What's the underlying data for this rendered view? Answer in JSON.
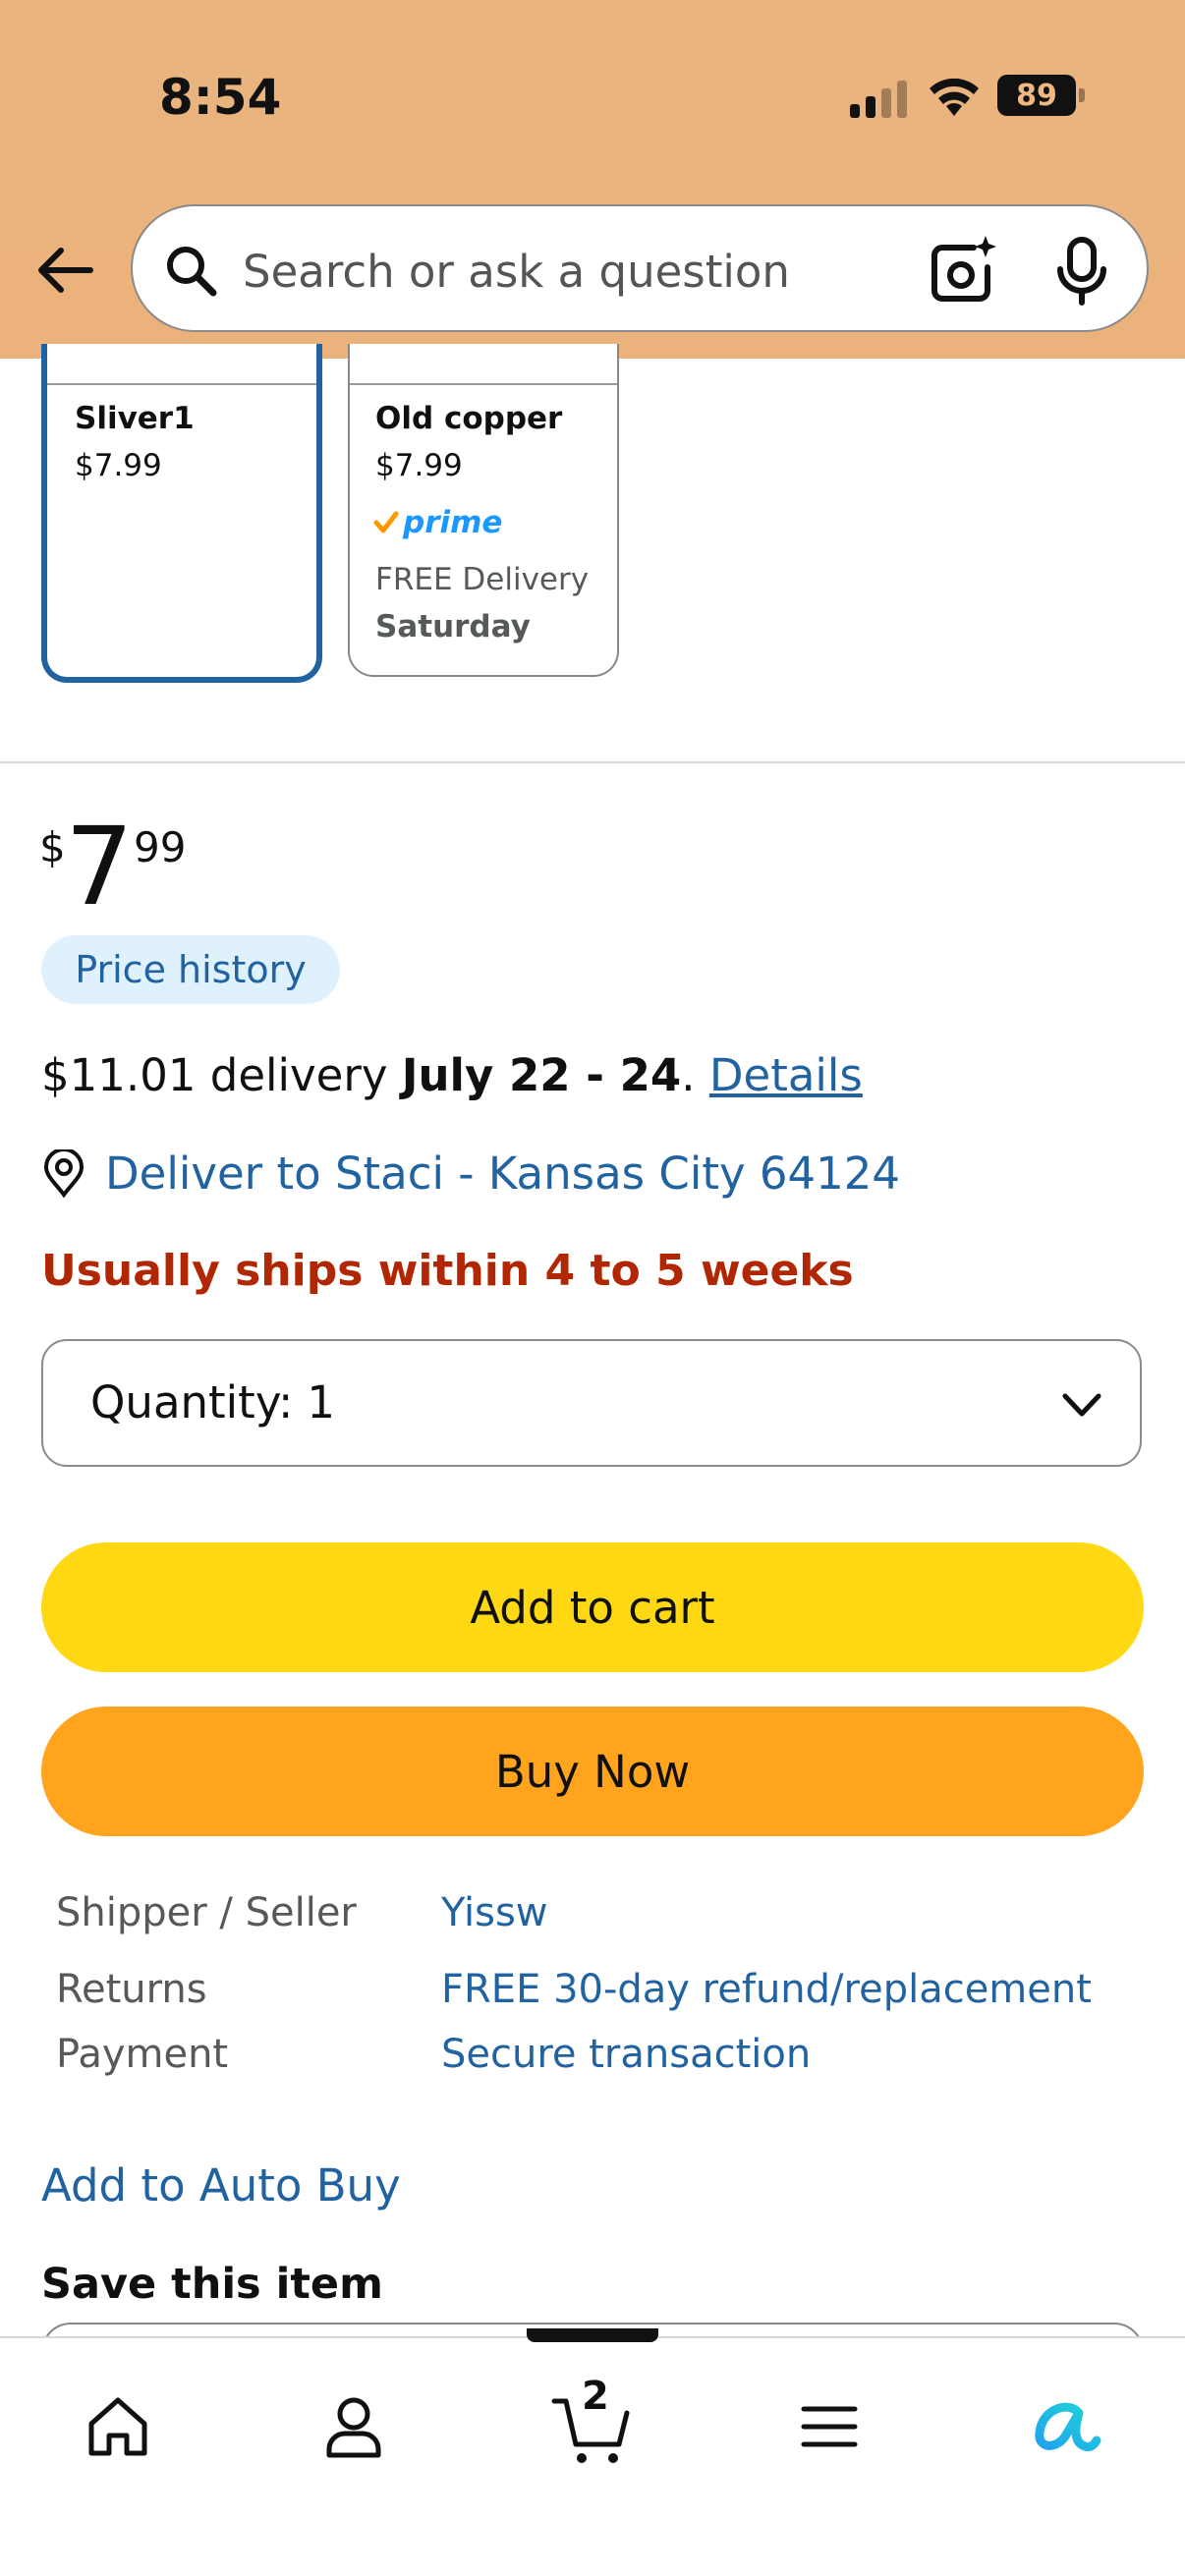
{
  "status_bar": {
    "time": "8:54",
    "battery": "89"
  },
  "header": {
    "search_placeholder": "Search or ask a question",
    "icons": [
      "back-arrow-icon",
      "search-icon",
      "camera-icon",
      "microphone-icon"
    ]
  },
  "variants": [
    {
      "name": "Sliver1",
      "price": "$7.99",
      "selected": true
    },
    {
      "name": "Old copper",
      "price": "$7.99",
      "prime": "prime",
      "delivery": "FREE Delivery",
      "delivery_day": "Saturday",
      "selected": false
    }
  ],
  "price": {
    "symbol": "$",
    "whole": "7",
    "fraction": "99",
    "history_label": "Price history"
  },
  "delivery": {
    "prefix": "$11.01 delivery ",
    "dates": "July 22 - 24",
    "separator": ". ",
    "details_link": "Details",
    "deliver_to": "Deliver to Staci - Kansas City 64124",
    "stock_message": "Usually ships within 4 to 5 weeks"
  },
  "quantity": {
    "label": "Quantity:",
    "value": "1"
  },
  "buttons": {
    "add_to_cart": "Add to cart",
    "buy_now": "Buy Now"
  },
  "info": [
    {
      "label": "Shipper / Seller",
      "value": "Yissw"
    },
    {
      "label": "Returns",
      "value": "FREE 30-day refund/replacement"
    },
    {
      "label": "Payment",
      "value": "Secure transaction"
    }
  ],
  "auto_buy": "Add to Auto Buy",
  "save_item": "Save this item",
  "bottom_nav": {
    "cart_count": "2",
    "items": [
      "home",
      "account",
      "cart",
      "menu",
      "rufus"
    ]
  },
  "colors": {
    "header_bg": "#eab47e",
    "link": "#2162a1",
    "stock_warning": "#b12704",
    "add_to_cart": "#ffd814",
    "buy_now": "#ffa41c",
    "selected_border": "#2162a1",
    "price_history_bg": "#dff1fd"
  }
}
